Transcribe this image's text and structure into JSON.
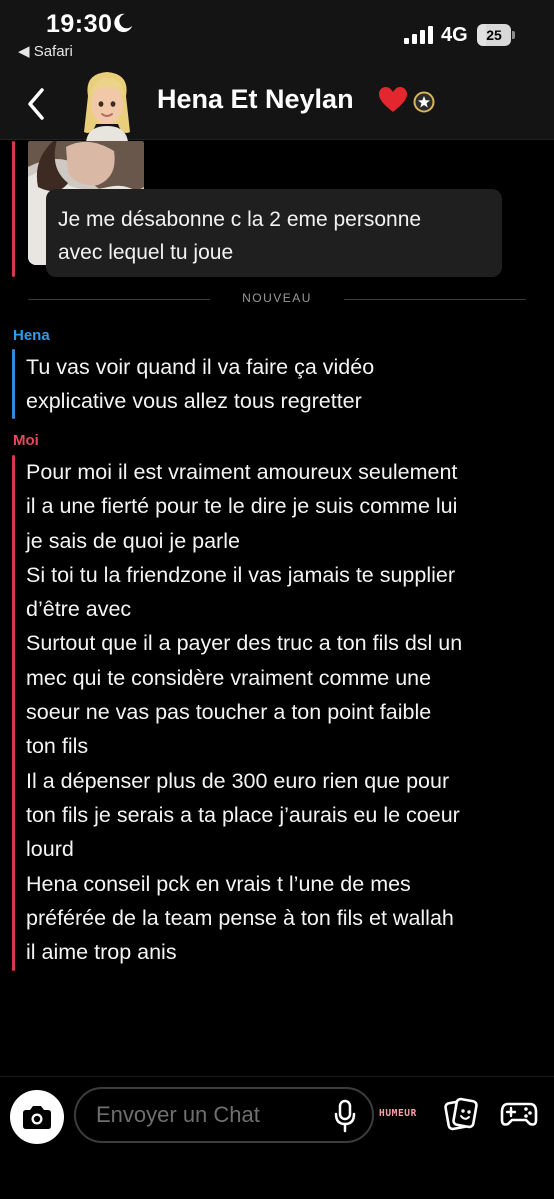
{
  "status_bar": {
    "time": "19:30",
    "back_app": "◀ Safari",
    "network": "4G",
    "battery_level": "25",
    "battery_fraction": 0.25
  },
  "header": {
    "title": "Hena Et Neylan",
    "icons": [
      "back-chevron-icon",
      "bitmoji-avatar",
      "heart-icon",
      "star-badge-icon"
    ]
  },
  "chat": {
    "reply_bubble": "Je me désabonne c la 2 eme personne avec lequel tu joue",
    "reply_lines": [
      "Je me désabonne c la 2 eme personne",
      "avec lequel tu joue"
    ],
    "divider_label": "NOUVEAU",
    "messages": [
      {
        "sender": "Hena",
        "lines": [
          "Tu vas voir quand il va faire ça vidéo",
          "explicative vous allez tous regretter"
        ]
      },
      {
        "sender": "Moi",
        "lines": [
          "Pour moi il est vraiment amoureux seulement",
          "il a une fierté pour te le dire je suis comme lui",
          "je sais de quoi je parle",
          "Si toi tu la friendzone il vas jamais te supplier",
          "d’être avec",
          "Surtout que il a payer des truc a ton fils dsl un",
          "mec qui te considère vraiment comme une",
          "soeur ne vas pas toucher a ton point faible",
          "ton fils",
          "Il a dépenser plus de 300 euro rien que pour",
          "ton fils je serais a ta place j’aurais eu le coeur",
          "lourd",
          "Hena conseil pck en vrais t l’une de mes",
          "préférée de la team pense à ton fils et wallah",
          "il aime trop anis"
        ]
      }
    ]
  },
  "bottom_bar": {
    "input_placeholder": "Envoyer un Chat",
    "humeur_label": "HUMEUR",
    "icons": [
      "camera-icon",
      "microphone-icon",
      "sticker-icon",
      "game-controller-icon"
    ]
  },
  "colors": {
    "background": "#000000",
    "bar_background": "#141414",
    "hena_accent": "#2f9ae8",
    "moi_accent": "#e24b5a",
    "bubble": "#1f1f1f"
  }
}
